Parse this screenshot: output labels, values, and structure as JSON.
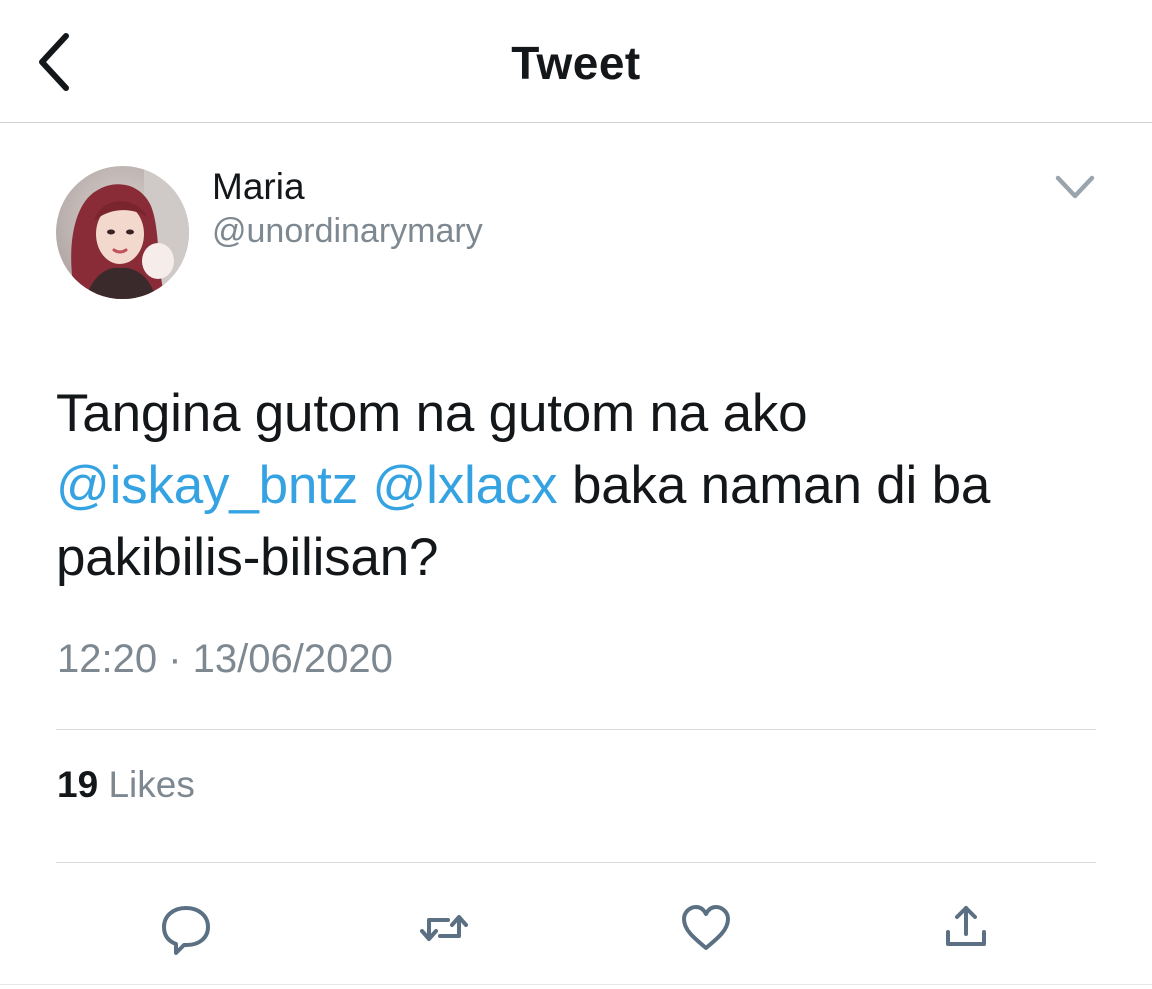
{
  "header": {
    "title": "Tweet",
    "back_icon": "chevron-left-icon"
  },
  "tweet": {
    "author": {
      "display_name": "Maria",
      "handle": "@unordinarymary",
      "avatar_icon": "profile-photo"
    },
    "menu_icon": "chevron-down-icon",
    "text": {
      "part1": "Tangina gutom na gutom na ako ",
      "mention1": "@iskay_bntz",
      "space": " ",
      "mention2": "@lxlacx",
      "part2": " baka naman di ba pakibilis-bilisan?"
    },
    "timestamp": "12:20 · 13/06/2020",
    "likes": {
      "count": "19",
      "label": "Likes"
    }
  },
  "actions": [
    {
      "icon": "reply-icon"
    },
    {
      "icon": "retweet-icon"
    },
    {
      "icon": "like-icon"
    },
    {
      "icon": "share-icon"
    }
  ],
  "colors": {
    "mention": "#35a3e2",
    "secondary_text": "#7d8891",
    "primary_text": "#14171a",
    "icon": "#5b7083"
  }
}
